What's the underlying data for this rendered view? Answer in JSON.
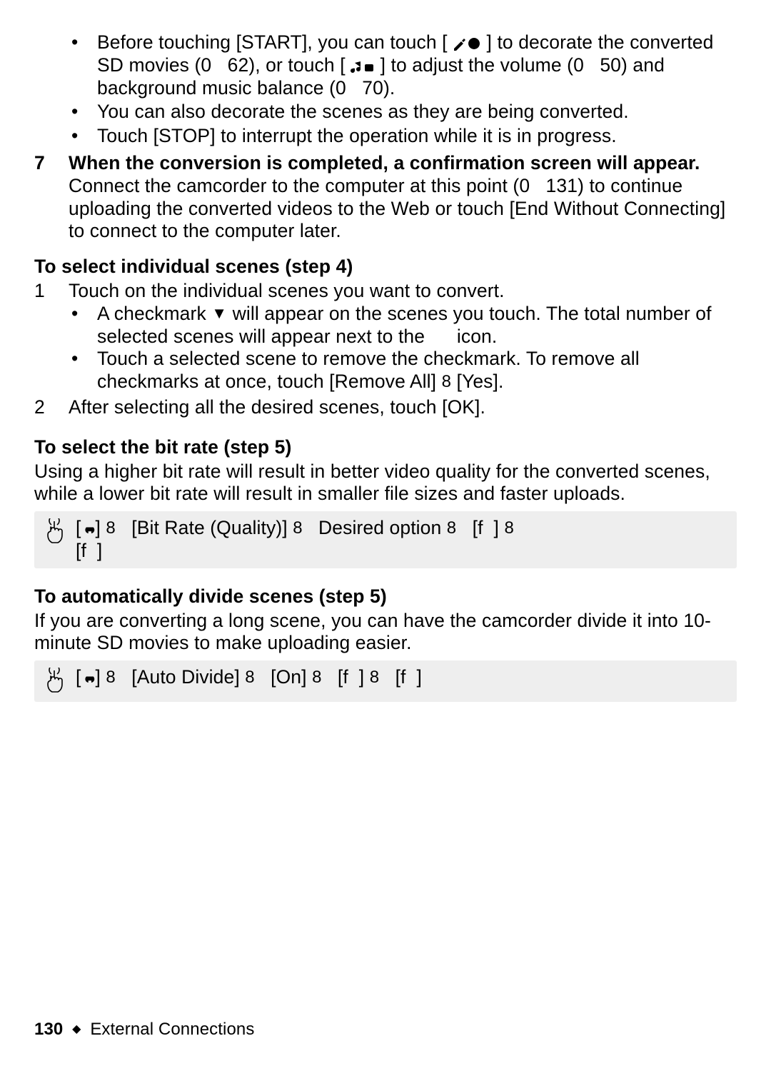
{
  "top_bullets": {
    "b1_prefix": "Before touching [START], you can touch [",
    "b1_mid": "] to decorate the converted SD movies (",
    "b1_ref1_sym": "0",
    "b1_ref1_num": "62",
    "b1_mid2": "), or touch [",
    "b1_mid3": "] to adjust the volume (",
    "b1_ref2_sym": "0",
    "b1_ref2_num": "50",
    "b1_mid4": ") and background music balance (",
    "b1_ref3_sym": "0",
    "b1_ref3_num": "70",
    "b1_end": ").",
    "b2": "You can also decorate the scenes as they are being converted.",
    "b3": "Touch [STOP] to interrupt the operation while it is in progress."
  },
  "step7": {
    "num": "7",
    "title": "When the conversion is completed, a confirmation screen will appear.",
    "body_a": "Connect the camcorder to the computer at this point (",
    "body_ref_sym": "0",
    "body_ref_num": "131",
    "body_b": ") to continue uploading the converted videos to the Web or touch [End Without Connecting] to connect to the computer later."
  },
  "select_scenes": {
    "heading": "To select individual scenes (step 4)",
    "s1_num": "1",
    "s1": "Touch on the individual scenes you want to convert.",
    "s1_b1_a": "A checkmark ",
    "s1_b1_b": " will appear on the scenes you touch. The total number of selected scenes will appear next to the ",
    "s1_b1_c": " icon.",
    "s1_b2": "Touch a selected scene to remove the checkmark. To remove all checkmarks at once, touch [Remove All] ",
    "s1_b2_arrow": "8",
    "s1_b2_c": " [Yes].",
    "s2_num": "2",
    "s2": "After selecting all the desired scenes, touch [OK]."
  },
  "bit_rate": {
    "heading": "To select the bit rate (step 5)",
    "para": "Using a higher bit rate will result in better video quality for the converted scenes, while a lower bit rate will result in smaller file sizes and faster uploads.",
    "proc": {
      "step1_open": "[",
      "step1_close": "]",
      "arrow": "8",
      "step2": "[Bit Rate (Quality)]",
      "step3": "Desired option",
      "step4_open": "[",
      "step4_sym": "f",
      "step4_close": "]",
      "step5_open": "[",
      "step5_sym": "f",
      "step5_close": "]"
    }
  },
  "auto_divide": {
    "heading": "To automatically divide scenes (step 5)",
    "para": "If you are converting a long scene, you can have the camcorder divide it into 10-minute SD movies to make uploading easier.",
    "proc": {
      "step1_open": "[",
      "step1_close": "]",
      "arrow": "8",
      "step2": "[Auto Divide]",
      "step3": "[On]",
      "step4_open": "[",
      "step4_sym": "f",
      "step4_close": "]",
      "step5_open": "[",
      "step5_sym": "f",
      "step5_close": "]"
    }
  },
  "footer": {
    "page": "130",
    "section": "External Connections"
  },
  "icons": {
    "wrench": "✒",
    "down_tri": "▼",
    "checkmark_tri": "▼"
  }
}
